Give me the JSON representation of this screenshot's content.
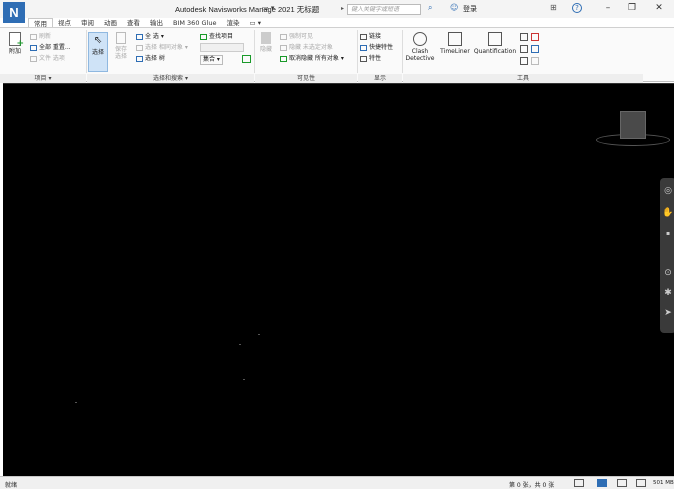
{
  "app": {
    "logo_letter": "N"
  },
  "titlebar": {
    "qat_label": "▭ ▾",
    "title": "Autodesk Navisworks Manage 2021   无标题",
    "search_placeholder": "键入关键字或短语",
    "search_arrow": "▸",
    "binoculars_icon": "⌕",
    "user_icon": "☺",
    "signin_label": "登录",
    "cart_icon": "⊞",
    "help_icon": "?",
    "minimize_label": "–",
    "maximize_label": "❐",
    "close_label": "✕"
  },
  "tabs": [
    {
      "label": "常用",
      "active": true
    },
    {
      "label": "视点"
    },
    {
      "label": "审阅"
    },
    {
      "label": "动画"
    },
    {
      "label": "查看"
    },
    {
      "label": "输出"
    },
    {
      "label": "BIM 360 Glue"
    },
    {
      "label": "渲染"
    },
    {
      "label": "▭ ▾"
    }
  ],
  "ribbon": {
    "project": {
      "append": "附加",
      "refresh": "刷新",
      "reset_all": "全部 重置...",
      "file_options": "文件 选项",
      "panel": "项目 ▾"
    },
    "select_search": {
      "select": "选择",
      "save_selection": "保存 选择",
      "select_all": "全 选 ▾",
      "select_same": "选择 相同对象 ▾",
      "select_tree": "选择 树",
      "find_items": "查找项目",
      "sets": "集合 ▾",
      "panel": "选择和搜索 ▾"
    },
    "visibility": {
      "hide": "隐藏",
      "require": "强制可见",
      "hide_unselected": "隐藏 未选定对象",
      "unhide_all": "取消隐藏 所有对象 ▾",
      "panel": "可见性"
    },
    "display": {
      "links": "链接",
      "quick_props": "快捷特性",
      "properties": "特性",
      "panel": "显示"
    },
    "tools": {
      "clash": "Clash Detective",
      "timeliner": "TimeLiner",
      "quantification": "Quantification",
      "panel": "工具"
    }
  },
  "navbar": {
    "wheel_icon": "◎",
    "pan_icon": "✋",
    "zoom_icon": "▪",
    "orbit_icon": "⊙",
    "look_icon": "✱",
    "select_icon": "➤"
  },
  "statusbar": {
    "status": "就绪",
    "sheet": "第 0 张，共 0 张",
    "memory": "501 MB"
  }
}
